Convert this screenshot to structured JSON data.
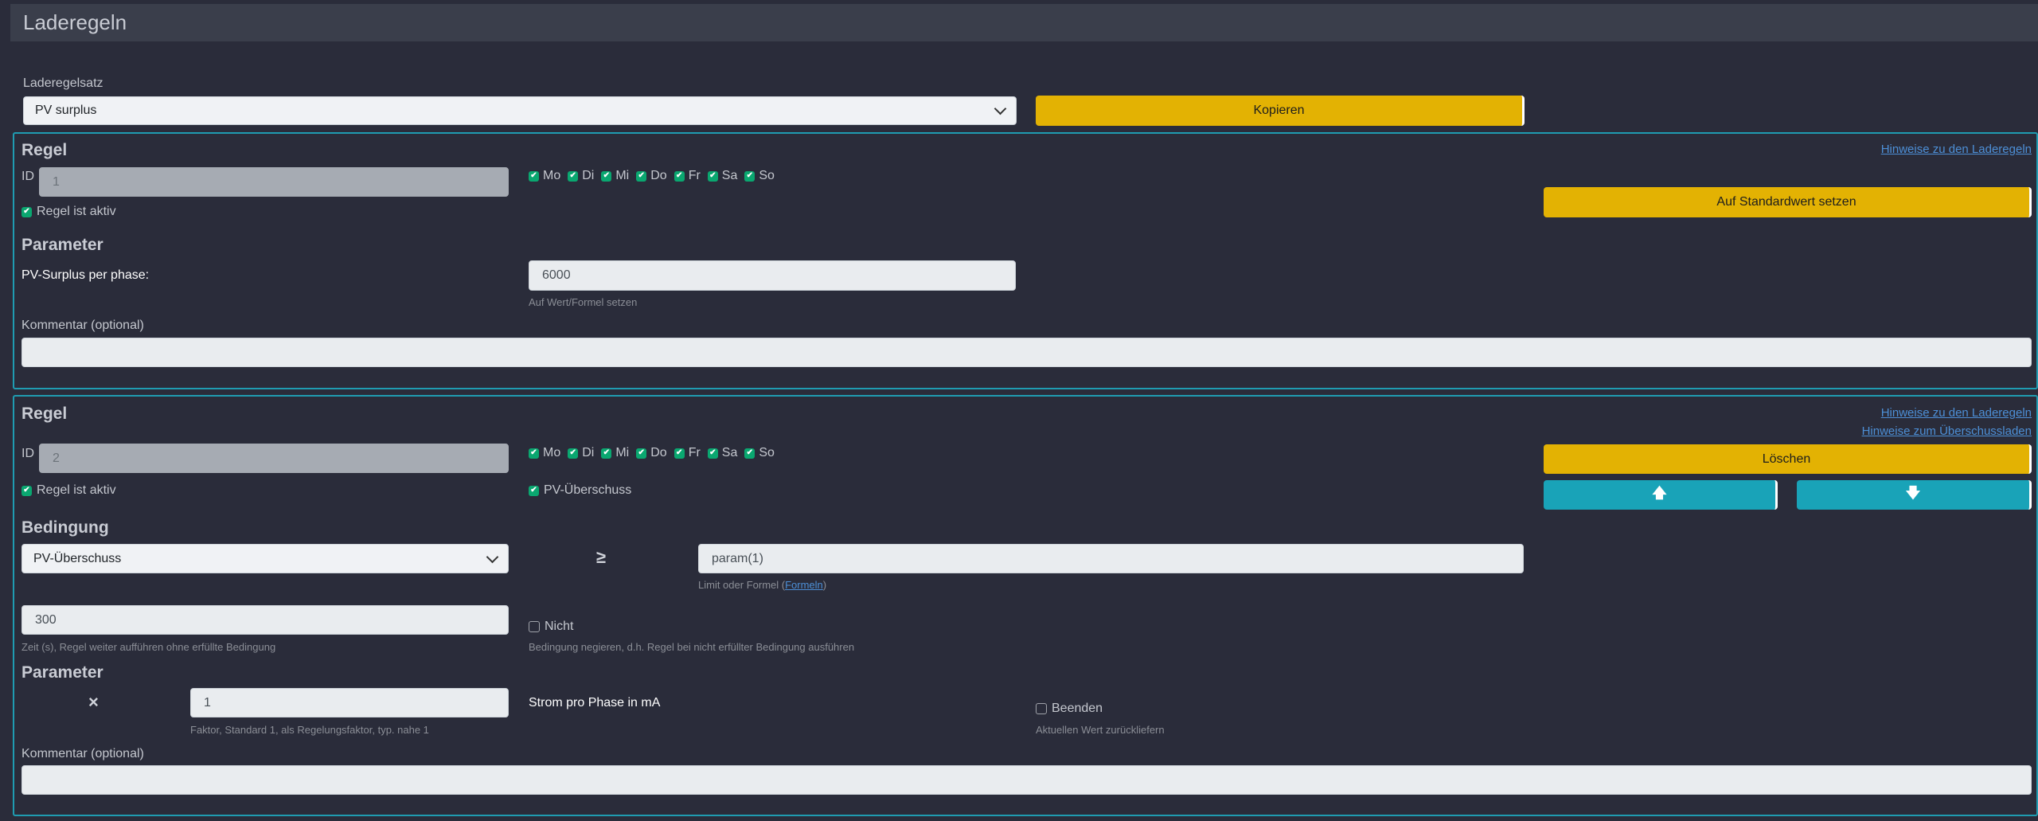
{
  "header": {
    "title": "Laderegeln"
  },
  "ruleset": {
    "label": "Laderegelsatz",
    "selected": "PV surplus",
    "copy_button": "Kopieren"
  },
  "days": [
    "Mo",
    "Di",
    "Mi",
    "Do",
    "Fr",
    "Sa",
    "So"
  ],
  "rule1": {
    "title": "Regel",
    "id_label": "ID",
    "id_value": "1",
    "active_label": "Regel ist aktiv",
    "help_link": "Hinweise zu den Laderegeln",
    "default_button": "Auf Standardwert setzen",
    "parameter_title": "Parameter",
    "param_label": "PV-Surplus per phase:",
    "param_value": "6000",
    "param_help": "Auf Wert/Formel setzen",
    "comment_label": "Kommentar (optional)",
    "comment_value": ""
  },
  "rule2": {
    "title": "Regel",
    "id_label": "ID",
    "id_value": "2",
    "active_label": "Regel ist aktiv",
    "pv_label": "PV-Überschuss",
    "help_link1": "Hinweise zu den Laderegeln",
    "help_link2": "Hinweise zum Überschussladen",
    "delete_button": "Löschen",
    "up_icon": "arrow-up-icon",
    "down_icon": "arrow-down-icon",
    "up_glyph": "🡅",
    "down_glyph": "🡇",
    "condition_title": "Bedingung",
    "condition_selected": "PV-Überschuss",
    "operator": "≥",
    "condition_value": "param(1)",
    "condition_help_prefix": "Limit oder Formel (",
    "condition_help_link": "Formeln",
    "condition_help_suffix": ")",
    "time_value": "300",
    "time_help": "Zeit (s), Regel weiter aufführen ohne erfüllte Bedingung",
    "not_label": "Nicht",
    "not_help": "Bedingung negieren, d.h. Regel bei nicht erfüllter Bedingung ausführen",
    "parameter_title": "Parameter",
    "multiply_symbol": "×",
    "factor_value": "1",
    "factor_help": "Faktor, Standard 1, als Regelungsfaktor, typ. nahe 1",
    "current_label": "Strom pro Phase in mA",
    "end_label": "Beenden",
    "end_help": "Aktuellen Wert zurückliefern",
    "comment_label": "Kommentar (optional)",
    "comment_value": ""
  },
  "colors": {
    "background": "#2a2c3a",
    "accent_yellow": "#e3b203",
    "accent_teal": "#19a3b8",
    "check_green": "#0aa770",
    "panel_border": "#1f9cb1"
  }
}
